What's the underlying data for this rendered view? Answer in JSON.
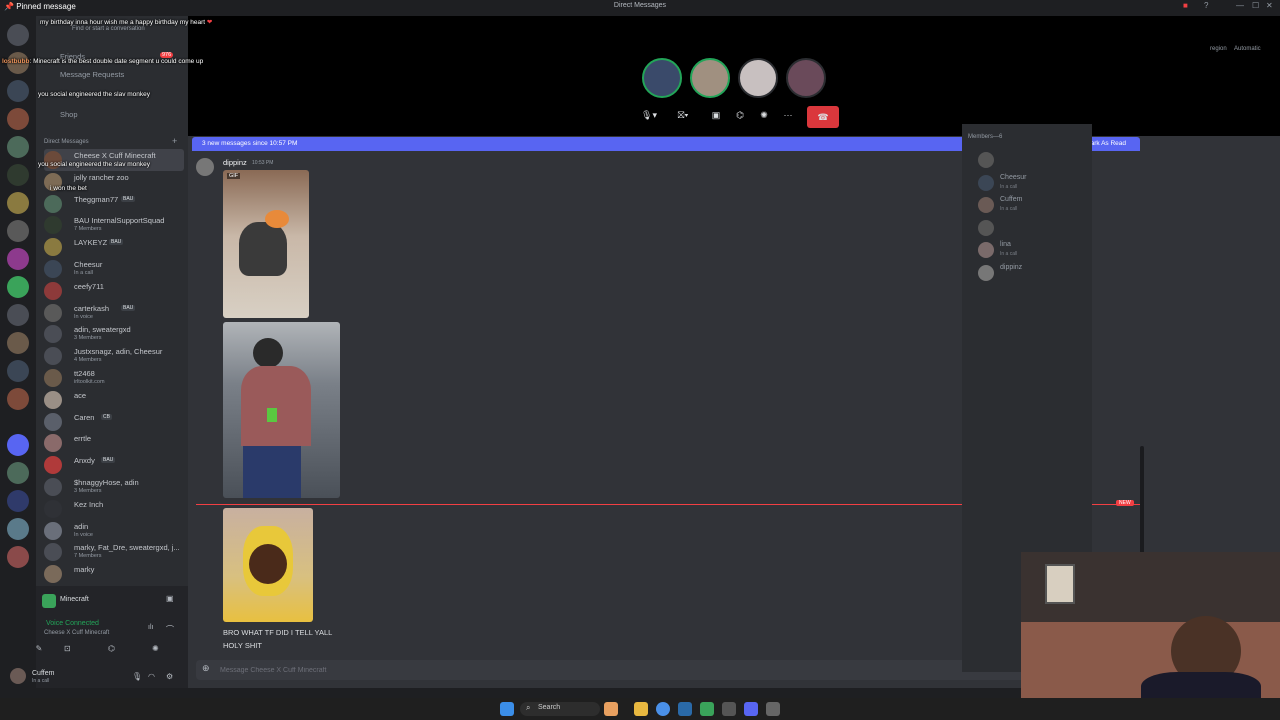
{
  "window": {
    "title": "Direct Messages",
    "region_label": "region",
    "region_value": "Automatic"
  },
  "overlay": {
    "pinned_label": "Pinned message",
    "pinned_text": "my birthday inna hour wish me a happy birthday my heart",
    "pinned_badge": "❤",
    "chat": [
      {
        "user": "lostbubb",
        "text": "Minecraft is the best double date segment u could come up"
      },
      {
        "user": "",
        "text": "you social engineered the slav monkey"
      },
      {
        "user": "",
        "text": "you social engineered the slav monkey"
      },
      {
        "user": "",
        "text": "i won the bet"
      }
    ]
  },
  "sidebar": {
    "find_placeholder": "Find or start a conversation",
    "friends": "Friends",
    "friends_badge": "976",
    "message_requests": "Message Requests",
    "shop": "Shop",
    "dm_header": "Direct Messages",
    "dms": [
      {
        "name": "Cheese X Cuff Minecraft",
        "sub": "",
        "badge": "",
        "color": "#6b4a3a"
      },
      {
        "name": "jolly rancher zoo",
        "sub": "",
        "badge": "",
        "color": "#7d6b55"
      },
      {
        "name": "Theggman77",
        "sub": "",
        "badge": "BAU",
        "color": "#4c6a5a"
      },
      {
        "name": "BAU InternalSupportSquad",
        "sub": "7 Members",
        "badge": "",
        "color": "#2f3a2f"
      },
      {
        "name": "LAYKEYZ",
        "sub": "",
        "badge": "BAU",
        "color": "#8a7a40"
      },
      {
        "name": "Cheesur",
        "sub": "In a call",
        "badge": "",
        "color": "#3b4655"
      },
      {
        "name": "ceefy711",
        "sub": "",
        "badge": "",
        "color": "#8d3a3a"
      },
      {
        "name": "carterkash",
        "sub": "In voice",
        "badge": "BAU",
        "color": "#595959"
      },
      {
        "name": "adin, sweatergxd",
        "sub": "3 Members",
        "badge": "",
        "color": "#4a4d55"
      },
      {
        "name": "Justxsnagz, adin, Cheesur",
        "sub": "4 Members",
        "badge": "",
        "color": "#4a4d55"
      },
      {
        "name": "tt2468",
        "sub": "irltoolkit.com",
        "badge": "",
        "color": "#6a5a4a"
      },
      {
        "name": "ace",
        "sub": "",
        "badge": "",
        "color": "#9a8f86"
      },
      {
        "name": "Caren",
        "sub": "",
        "badge": "CB",
        "color": "#5a5f6a"
      },
      {
        "name": "errtle",
        "sub": "",
        "badge": "",
        "color": "#8a6a6a"
      },
      {
        "name": "Anxdy",
        "sub": "",
        "badge": "BAU",
        "color": "#b03a3a"
      },
      {
        "name": "$hnaggyHose, adin",
        "sub": "3 Members",
        "badge": "",
        "color": "#4a4d55"
      },
      {
        "name": "Kez Inch",
        "sub": "",
        "badge": "",
        "color": "#2f3136"
      },
      {
        "name": "adin",
        "sub": "In voice",
        "badge": "",
        "color": "#6a6f7a"
      },
      {
        "name": "marky, Fat_Dre, sweatergxd, j...",
        "sub": "7 Members",
        "badge": "",
        "color": "#4a4d55"
      },
      {
        "name": "marky",
        "sub": "",
        "badge": "",
        "color": "#7a6a5a"
      }
    ]
  },
  "voice": {
    "channel": "Minecraft",
    "status": "Voice Connected",
    "sub": "Cheese X Cuff Minecraft"
  },
  "user": {
    "name": "Cuffem",
    "status": "In a call"
  },
  "chat": {
    "new_messages": "3 new messages since 10:57 PM",
    "mark_read": "Mark As Read",
    "author": "dippinz",
    "time": "10:53 PM",
    "gif_label": "GIF",
    "new_label": "NEW",
    "message_text_1": "BRO WHAT TF DID I TELL YALL",
    "message_text_2": "HOLY SHIT",
    "composer_placeholder": "Message Cheese X Cuff Minecraft"
  },
  "members": {
    "header": "Members—6",
    "list": [
      {
        "name": "",
        "sub": "",
        "color": "#555"
      },
      {
        "name": "Cheesur",
        "sub": "In a call",
        "color": "#3b4655"
      },
      {
        "name": "Cuffem",
        "sub": "In a call",
        "color": "#6a5a55"
      },
      {
        "name": "",
        "sub": "",
        "color": "#555"
      },
      {
        "name": "lina",
        "sub": "In a call",
        "color": "#7a6a6a"
      },
      {
        "name": "dippinz",
        "sub": "",
        "color": "#777"
      }
    ]
  },
  "taskbar": {
    "search": "Search"
  }
}
